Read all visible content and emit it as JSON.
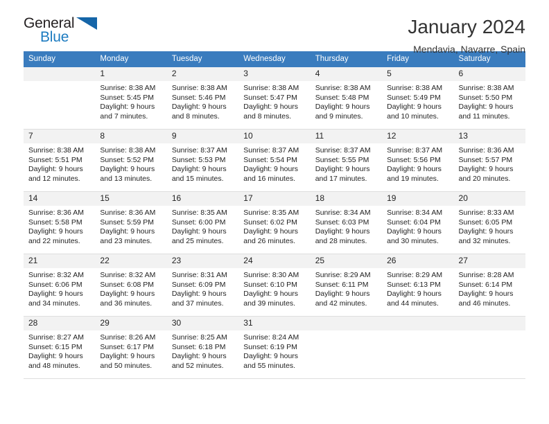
{
  "brand": {
    "name_part1": "General",
    "name_part2": "Blue",
    "triangle_icon": "triangle-icon",
    "color_dark": "#231f20",
    "color_blue": "#1c7bc0"
  },
  "header": {
    "title": "January 2024",
    "subtitle": "Mendavia, Navarre, Spain"
  },
  "theme": {
    "header_band": "#3a7cbe",
    "day_strip": "#f2f2f2",
    "grid_line": "#dedede"
  },
  "calendar": {
    "weekday_headers": [
      "Sunday",
      "Monday",
      "Tuesday",
      "Wednesday",
      "Thursday",
      "Friday",
      "Saturday"
    ],
    "weeks": [
      [
        {
          "day": "",
          "lines": [
            "",
            "",
            "",
            ""
          ]
        },
        {
          "day": "1",
          "lines": [
            "Sunrise: 8:38 AM",
            "Sunset: 5:45 PM",
            "Daylight: 9 hours",
            "and 7 minutes."
          ]
        },
        {
          "day": "2",
          "lines": [
            "Sunrise: 8:38 AM",
            "Sunset: 5:46 PM",
            "Daylight: 9 hours",
            "and 8 minutes."
          ]
        },
        {
          "day": "3",
          "lines": [
            "Sunrise: 8:38 AM",
            "Sunset: 5:47 PM",
            "Daylight: 9 hours",
            "and 8 minutes."
          ]
        },
        {
          "day": "4",
          "lines": [
            "Sunrise: 8:38 AM",
            "Sunset: 5:48 PM",
            "Daylight: 9 hours",
            "and 9 minutes."
          ]
        },
        {
          "day": "5",
          "lines": [
            "Sunrise: 8:38 AM",
            "Sunset: 5:49 PM",
            "Daylight: 9 hours",
            "and 10 minutes."
          ]
        },
        {
          "day": "6",
          "lines": [
            "Sunrise: 8:38 AM",
            "Sunset: 5:50 PM",
            "Daylight: 9 hours",
            "and 11 minutes."
          ]
        }
      ],
      [
        {
          "day": "7",
          "lines": [
            "Sunrise: 8:38 AM",
            "Sunset: 5:51 PM",
            "Daylight: 9 hours",
            "and 12 minutes."
          ]
        },
        {
          "day": "8",
          "lines": [
            "Sunrise: 8:38 AM",
            "Sunset: 5:52 PM",
            "Daylight: 9 hours",
            "and 13 minutes."
          ]
        },
        {
          "day": "9",
          "lines": [
            "Sunrise: 8:37 AM",
            "Sunset: 5:53 PM",
            "Daylight: 9 hours",
            "and 15 minutes."
          ]
        },
        {
          "day": "10",
          "lines": [
            "Sunrise: 8:37 AM",
            "Sunset: 5:54 PM",
            "Daylight: 9 hours",
            "and 16 minutes."
          ]
        },
        {
          "day": "11",
          "lines": [
            "Sunrise: 8:37 AM",
            "Sunset: 5:55 PM",
            "Daylight: 9 hours",
            "and 17 minutes."
          ]
        },
        {
          "day": "12",
          "lines": [
            "Sunrise: 8:37 AM",
            "Sunset: 5:56 PM",
            "Daylight: 9 hours",
            "and 19 minutes."
          ]
        },
        {
          "day": "13",
          "lines": [
            "Sunrise: 8:36 AM",
            "Sunset: 5:57 PM",
            "Daylight: 9 hours",
            "and 20 minutes."
          ]
        }
      ],
      [
        {
          "day": "14",
          "lines": [
            "Sunrise: 8:36 AM",
            "Sunset: 5:58 PM",
            "Daylight: 9 hours",
            "and 22 minutes."
          ]
        },
        {
          "day": "15",
          "lines": [
            "Sunrise: 8:36 AM",
            "Sunset: 5:59 PM",
            "Daylight: 9 hours",
            "and 23 minutes."
          ]
        },
        {
          "day": "16",
          "lines": [
            "Sunrise: 8:35 AM",
            "Sunset: 6:00 PM",
            "Daylight: 9 hours",
            "and 25 minutes."
          ]
        },
        {
          "day": "17",
          "lines": [
            "Sunrise: 8:35 AM",
            "Sunset: 6:02 PM",
            "Daylight: 9 hours",
            "and 26 minutes."
          ]
        },
        {
          "day": "18",
          "lines": [
            "Sunrise: 8:34 AM",
            "Sunset: 6:03 PM",
            "Daylight: 9 hours",
            "and 28 minutes."
          ]
        },
        {
          "day": "19",
          "lines": [
            "Sunrise: 8:34 AM",
            "Sunset: 6:04 PM",
            "Daylight: 9 hours",
            "and 30 minutes."
          ]
        },
        {
          "day": "20",
          "lines": [
            "Sunrise: 8:33 AM",
            "Sunset: 6:05 PM",
            "Daylight: 9 hours",
            "and 32 minutes."
          ]
        }
      ],
      [
        {
          "day": "21",
          "lines": [
            "Sunrise: 8:32 AM",
            "Sunset: 6:06 PM",
            "Daylight: 9 hours",
            "and 34 minutes."
          ]
        },
        {
          "day": "22",
          "lines": [
            "Sunrise: 8:32 AM",
            "Sunset: 6:08 PM",
            "Daylight: 9 hours",
            "and 36 minutes."
          ]
        },
        {
          "day": "23",
          "lines": [
            "Sunrise: 8:31 AM",
            "Sunset: 6:09 PM",
            "Daylight: 9 hours",
            "and 37 minutes."
          ]
        },
        {
          "day": "24",
          "lines": [
            "Sunrise: 8:30 AM",
            "Sunset: 6:10 PM",
            "Daylight: 9 hours",
            "and 39 minutes."
          ]
        },
        {
          "day": "25",
          "lines": [
            "Sunrise: 8:29 AM",
            "Sunset: 6:11 PM",
            "Daylight: 9 hours",
            "and 42 minutes."
          ]
        },
        {
          "day": "26",
          "lines": [
            "Sunrise: 8:29 AM",
            "Sunset: 6:13 PM",
            "Daylight: 9 hours",
            "and 44 minutes."
          ]
        },
        {
          "day": "27",
          "lines": [
            "Sunrise: 8:28 AM",
            "Sunset: 6:14 PM",
            "Daylight: 9 hours",
            "and 46 minutes."
          ]
        }
      ],
      [
        {
          "day": "28",
          "lines": [
            "Sunrise: 8:27 AM",
            "Sunset: 6:15 PM",
            "Daylight: 9 hours",
            "and 48 minutes."
          ]
        },
        {
          "day": "29",
          "lines": [
            "Sunrise: 8:26 AM",
            "Sunset: 6:17 PM",
            "Daylight: 9 hours",
            "and 50 minutes."
          ]
        },
        {
          "day": "30",
          "lines": [
            "Sunrise: 8:25 AM",
            "Sunset: 6:18 PM",
            "Daylight: 9 hours",
            "and 52 minutes."
          ]
        },
        {
          "day": "31",
          "lines": [
            "Sunrise: 8:24 AM",
            "Sunset: 6:19 PM",
            "Daylight: 9 hours",
            "and 55 minutes."
          ]
        },
        {
          "day": "",
          "lines": [
            "",
            "",
            "",
            ""
          ]
        },
        {
          "day": "",
          "lines": [
            "",
            "",
            "",
            ""
          ]
        },
        {
          "day": "",
          "lines": [
            "",
            "",
            "",
            ""
          ]
        }
      ]
    ]
  }
}
